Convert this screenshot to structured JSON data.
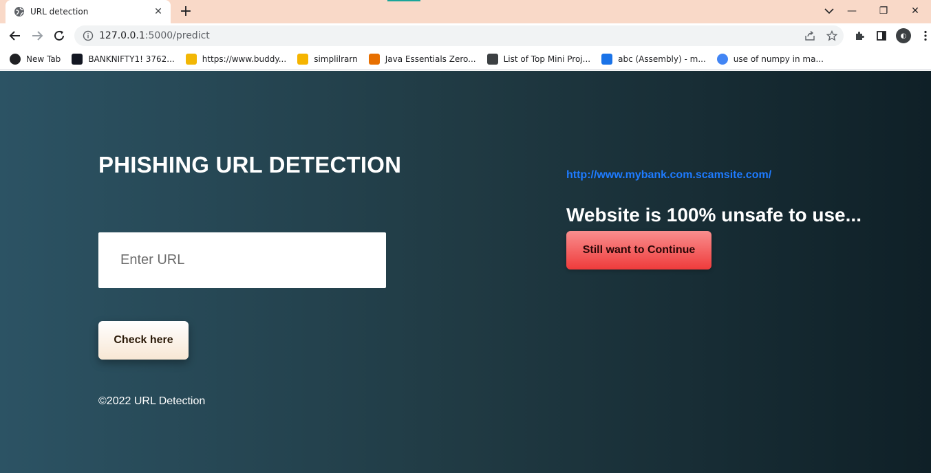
{
  "browser": {
    "tab": {
      "title": "URL detection",
      "close_glyph": "✕"
    },
    "new_tab_glyph": "+",
    "url": {
      "host": "127.0.0.1",
      "rest": ":5000/predict"
    },
    "window_controls": {
      "minimize": "—",
      "maximize": "❐",
      "close": "✕"
    },
    "bookmarks": [
      {
        "label": "New Tab",
        "icon": "globe-icon",
        "color": "#202124"
      },
      {
        "label": "BANKNIFTY1! 3762...",
        "icon": "tradingview-icon",
        "color": "#131722"
      },
      {
        "label": "https://www.buddy...",
        "icon": "graduation-cap-icon",
        "color": "#f2b705"
      },
      {
        "label": "simplilrarn",
        "icon": "simplilearn-icon",
        "color": "#f5b400"
      },
      {
        "label": "Java Essentials Zero...",
        "icon": "java-icon",
        "color": "#e76f00"
      },
      {
        "label": "List of Top Mini Proj...",
        "icon": "shield-icon",
        "color": "#3c4043"
      },
      {
        "label": "abc (Assembly) - m...",
        "icon": "diamond-icon",
        "color": "#1a73e8"
      },
      {
        "label": "use of numpy in ma...",
        "icon": "google-icon",
        "color": "#4285f4"
      }
    ]
  },
  "page": {
    "title": "PHISHING URL DETECTION",
    "input_placeholder": "Enter URL",
    "check_button": "Check here",
    "footer": "©2022 URL Detection",
    "result_url": "http://www.mybank.com.scamsite.com/",
    "result_message": "Website is 100% unsafe to use...",
    "continue_button": "Still want to Continue"
  },
  "colors": {
    "gradient_start": "#2c5364",
    "gradient_end": "#0f2027",
    "link": "#1e7bff",
    "danger": "#ef3b3b"
  }
}
